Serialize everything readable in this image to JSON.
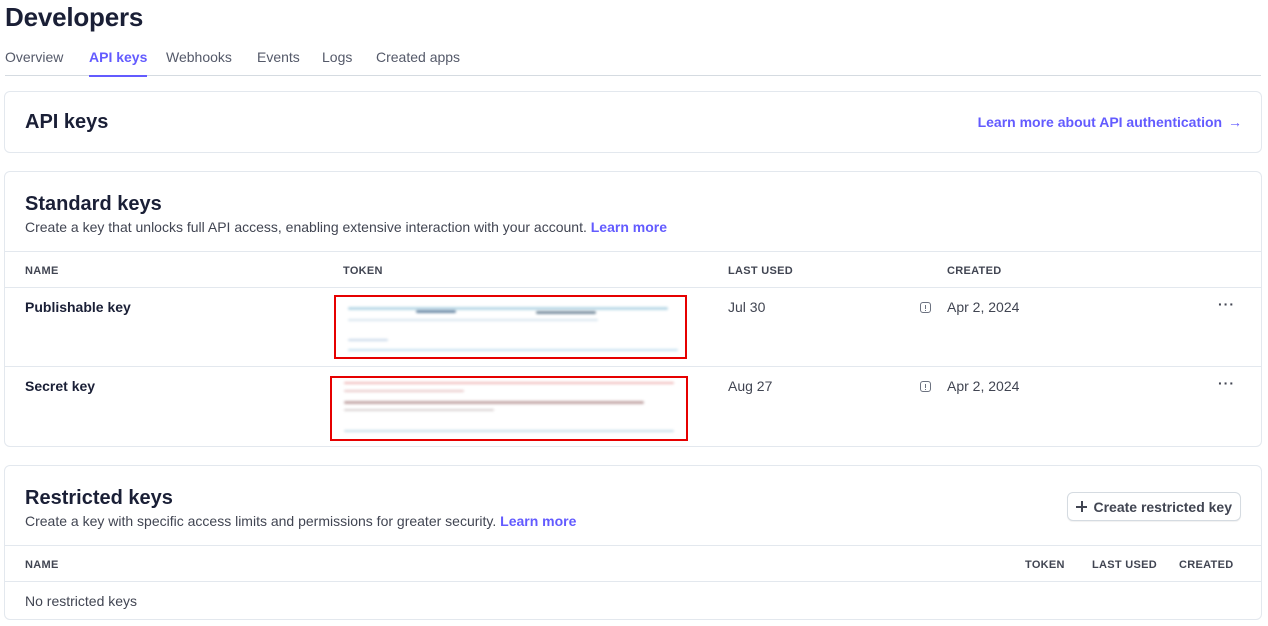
{
  "page": {
    "title": "Developers"
  },
  "tabs": [
    {
      "label": "Overview"
    },
    {
      "label": "API keys"
    },
    {
      "label": "Webhooks"
    },
    {
      "label": "Events"
    },
    {
      "label": "Logs"
    },
    {
      "label": "Created apps"
    }
  ],
  "active_tab": "API keys",
  "api_keys_card": {
    "title": "API keys",
    "auth_link": "Learn more about API authentication",
    "auth_link_arrow": "→"
  },
  "standard": {
    "title": "Standard keys",
    "description": "Create a key that unlocks full API access, enabling extensive interaction with your account.",
    "learn_more": "Learn more",
    "columns": {
      "name": "NAME",
      "token": "TOKEN",
      "last_used": "LAST USED",
      "created": "CREATED"
    },
    "rows": [
      {
        "name": "Publishable key",
        "token": "",
        "last_used": "Jul 30",
        "created": "Apr 2, 2024",
        "menu": "···"
      },
      {
        "name": "Secret key",
        "token": "",
        "last_used": "Aug 27",
        "created": "Apr 2, 2024",
        "menu": "···"
      }
    ]
  },
  "restricted": {
    "title": "Restricted keys",
    "description": "Create a key with specific access limits and permissions for greater security.",
    "learn_more": "Learn more",
    "create_button": "Create restricted key",
    "columns": {
      "name": "NAME",
      "token": "TOKEN",
      "last_used": "LAST USED",
      "created": "CREATED"
    },
    "empty_text": "No restricted keys"
  },
  "colors": {
    "accent": "#635bff",
    "redaction_border": "#e60000",
    "text": "#1a1f36"
  }
}
